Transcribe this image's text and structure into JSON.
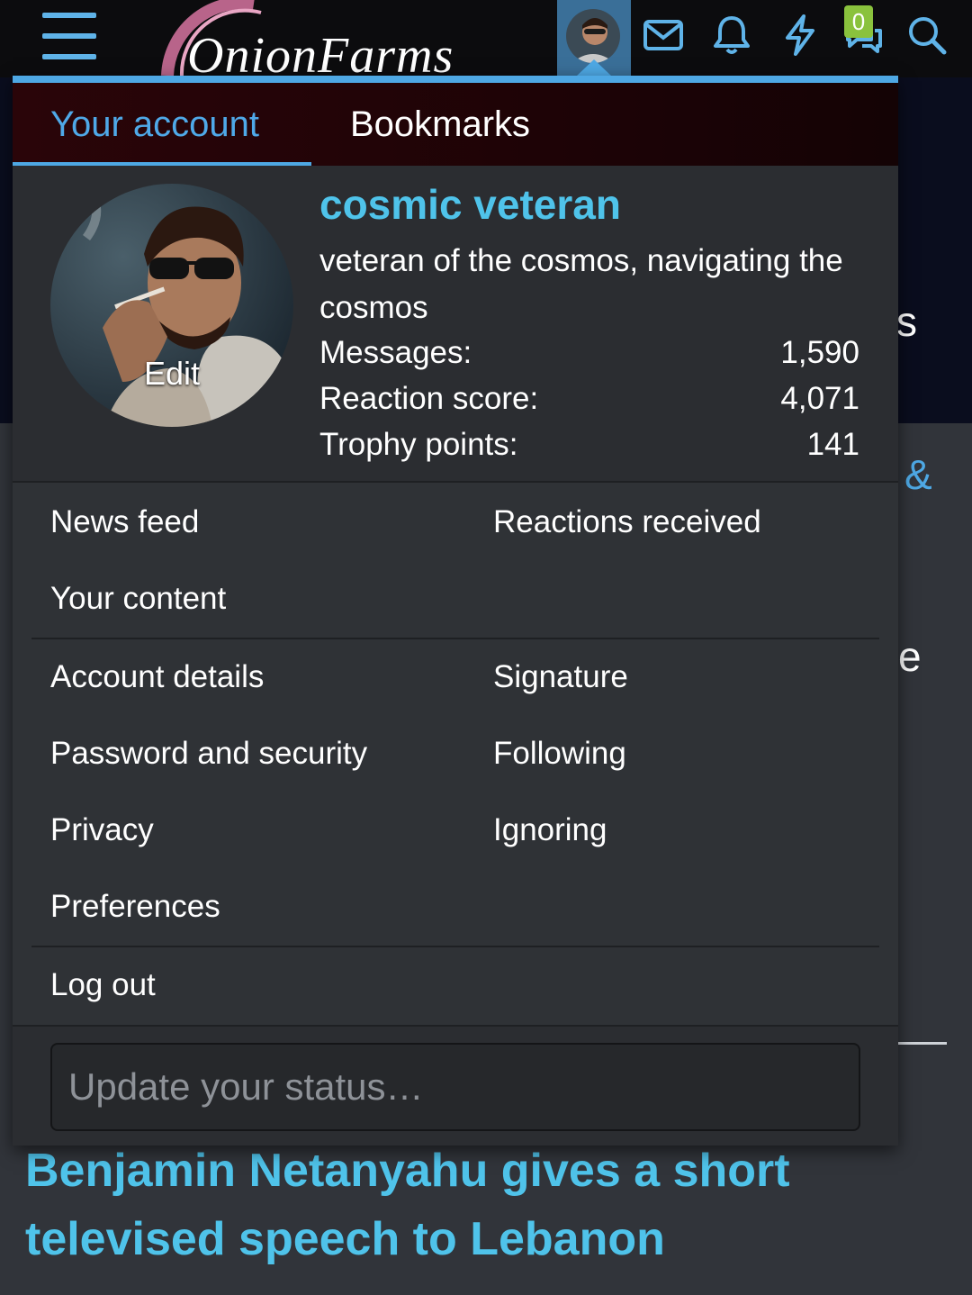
{
  "header": {
    "logo_text": "OnionFarms",
    "alert_badge": "0",
    "colors": {
      "accent": "#4ea8e4",
      "badge": "#8ac23d",
      "bar": "#0c0c0e"
    },
    "icons": [
      "hamburger-menu-icon",
      "avatar",
      "inbox-envelope-icon",
      "bell-icon",
      "lightning-icon",
      "conversations-icon",
      "search-icon"
    ]
  },
  "background": {
    "letter_s": "s",
    "letter_amp": "&",
    "letter_e": "e",
    "headline": "Benjamin Netanyahu gives a short televised speech to Lebanon"
  },
  "menu": {
    "tabs": [
      {
        "label": "Your account"
      },
      {
        "label": "Bookmarks"
      }
    ],
    "profile": {
      "edit_label": "Edit",
      "username": "cosmic veteran",
      "tagline": "veteran of the cosmos, navigating the cosmos",
      "stats": [
        {
          "label": "Messages:",
          "value": "1,590"
        },
        {
          "label": "Reaction score:",
          "value": "4,071"
        },
        {
          "label": "Trophy points:",
          "value": "141"
        }
      ]
    },
    "links": {
      "news_feed": "News feed",
      "reactions_received": "Reactions received",
      "your_content": "Your content",
      "account_details": "Account details",
      "signature": "Signature",
      "password_security": "Password and security",
      "following": "Following",
      "privacy": "Privacy",
      "ignoring": "Ignoring",
      "preferences": "Preferences",
      "log_out": "Log out"
    },
    "status": {
      "placeholder": "Update your status…"
    }
  }
}
